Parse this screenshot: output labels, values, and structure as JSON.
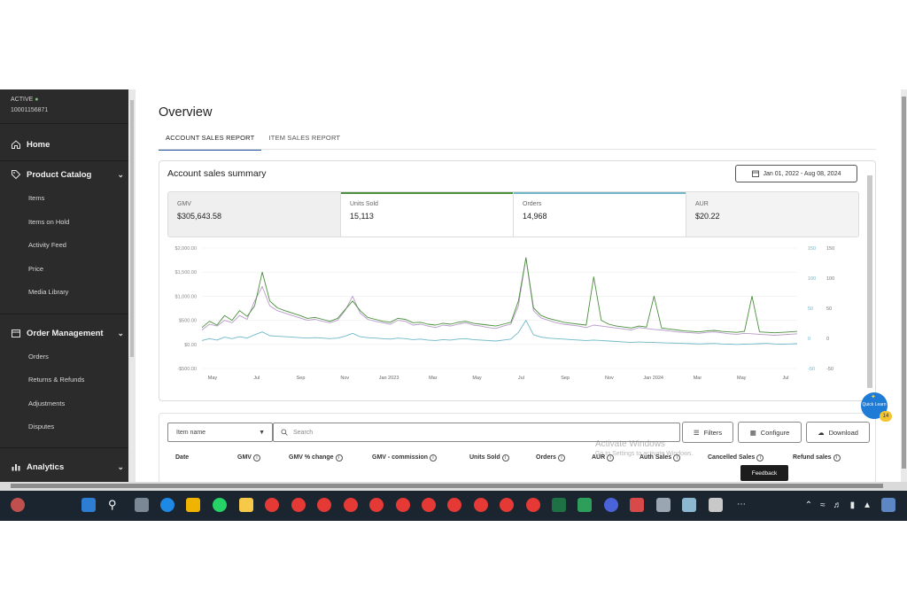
{
  "account": {
    "status": "ACTIVE",
    "status_dot": "●",
    "id": "10001156871"
  },
  "sidebar": {
    "home": "Home",
    "product_catalog": {
      "label": "Product Catalog",
      "items": [
        "Items",
        "Items on Hold",
        "Activity Feed",
        "Price",
        "Media Library"
      ]
    },
    "order_management": {
      "label": "Order Management",
      "items": [
        "Orders",
        "Returns & Refunds",
        "Adjustments",
        "Disputes"
      ]
    },
    "analytics": "Analytics"
  },
  "page": {
    "title": "Overview",
    "tabs": [
      {
        "label": "ACCOUNT SALES REPORT",
        "active": true
      },
      {
        "label": "ITEM SALES REPORT",
        "active": false
      }
    ]
  },
  "summary": {
    "title": "Account sales summary",
    "date_range": "Jan 01, 2022 - Aug 08, 2024",
    "metrics": [
      {
        "label": "GMV",
        "value": "$305,643.58",
        "accent": ""
      },
      {
        "label": "Units Sold",
        "value": "15,113",
        "accent": "#4a8f3c"
      },
      {
        "label": "Orders",
        "value": "14,968",
        "accent": "#6fb7c8"
      },
      {
        "label": "AUR",
        "value": "$20.22",
        "accent": ""
      }
    ]
  },
  "chart_data": {
    "type": "line",
    "left_axis_ticks": [
      "$2,000.00",
      "$1,500.00",
      "$1,000.00",
      "$500.00",
      "$0.00",
      "-$500.00"
    ],
    "right_axis_ticks_a": [
      "150",
      "100",
      "50",
      "0",
      "-50"
    ],
    "right_axis_ticks_b": [
      "150",
      "100",
      "50",
      "0",
      "-50"
    ],
    "x_tick_labels": [
      "May",
      "Jul",
      "Sep",
      "Nov",
      "Jan 2023",
      "Mar",
      "May",
      "Jul",
      "Sep",
      "Nov",
      "Jan 2024",
      "Mar",
      "May",
      "Jul"
    ],
    "series": [
      {
        "color": "#b79ac9",
        "values": [
          300,
          420,
          380,
          500,
          450,
          600,
          520,
          900,
          1200,
          800,
          700,
          650,
          600,
          550,
          500,
          520,
          480,
          450,
          500,
          700,
          1000,
          650,
          520,
          480,
          450,
          420,
          500,
          480,
          400,
          420,
          380,
          350,
          400,
          380,
          420,
          450,
          400,
          380,
          350,
          330,
          380,
          420,
          800,
          1800,
          700,
          550,
          500,
          450,
          420,
          400,
          380,
          350,
          400,
          380,
          360,
          340,
          320,
          300,
          350,
          330,
          310,
          300,
          280,
          260,
          250,
          240,
          230,
          250,
          260,
          240,
          220,
          210,
          230,
          220,
          210,
          200,
          190,
          200,
          210,
          220
        ]
      },
      {
        "color": "#4a8f3c",
        "values": [
          350,
          480,
          400,
          600,
          500,
          700,
          580,
          800,
          1500,
          900,
          760,
          700,
          650,
          600,
          540,
          560,
          520,
          480,
          540,
          720,
          900,
          700,
          560,
          520,
          480,
          460,
          540,
          520,
          450,
          460,
          420,
          400,
          440,
          420,
          460,
          480,
          440,
          420,
          400,
          380,
          420,
          460,
          900,
          1800,
          760,
          600,
          540,
          500,
          460,
          440,
          420,
          400,
          1400,
          500,
          420,
          380,
          360,
          340,
          380,
          360,
          1000,
          340,
          320,
          300,
          280,
          270,
          260,
          280,
          290,
          270,
          260,
          250,
          270,
          1000,
          260,
          250,
          240,
          250,
          260,
          270
        ]
      },
      {
        "color": "#6fb7c8",
        "values": [
          80,
          120,
          90,
          150,
          120,
          160,
          130,
          200,
          260,
          180,
          170,
          160,
          150,
          140,
          130,
          140,
          130,
          120,
          130,
          170,
          230,
          160,
          140,
          130,
          120,
          110,
          130,
          120,
          100,
          110,
          90,
          80,
          100,
          90,
          110,
          120,
          100,
          90,
          80,
          70,
          90,
          110,
          250,
          500,
          200,
          150,
          130,
          120,
          110,
          100,
          90,
          80,
          90,
          80,
          70,
          60,
          50,
          40,
          50,
          45,
          40,
          35,
          30,
          25,
          20,
          15,
          10,
          15,
          20,
          10,
          5,
          0,
          5,
          10,
          15,
          20,
          10,
          5,
          10,
          15
        ]
      }
    ]
  },
  "table": {
    "item_select": "Item name",
    "search_placeholder": "Search",
    "buttons": {
      "filters": "Filters",
      "configure": "Configure",
      "download": "Download"
    },
    "columns": [
      "Date",
      "GMV",
      "GMV % change",
      "GMV - commission",
      "Units Sold",
      "Orders",
      "AUR",
      "Auth Sales",
      "Cancelled Sales",
      "Refund sales"
    ]
  },
  "overlay": {
    "watermark_title": "Activate Windows",
    "watermark_sub": "Go to Settings to activate Windows.",
    "feedback": "Feedback",
    "quick_learn": "Quick Learn",
    "quick_badge": "14"
  }
}
